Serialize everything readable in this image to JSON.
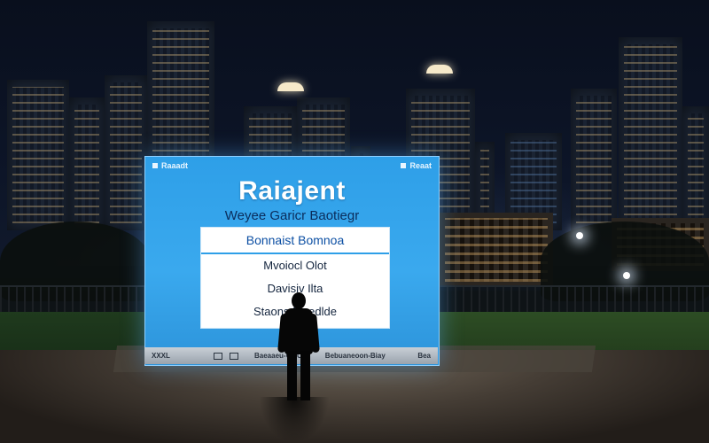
{
  "panel": {
    "topbar_left": "Raaadt",
    "topbar_right": "Reaat",
    "title": "Raiajent",
    "subtitle": "Weyee Garicr Baotiegr",
    "card": {
      "header": "Bonnaist Bomnoa",
      "items": [
        "Mvoiocl Olot",
        "Davisiv Ilta",
        "Staons Maedlde"
      ]
    },
    "footer": {
      "left": "XXXL",
      "mid1": "Baeaaeu-OOC",
      "mid2": "Bebuaneoon-Biay",
      "right": "Bea"
    }
  },
  "colors": {
    "panel_blue": "#2e9fe8",
    "card_header_text": "#0c4fa3",
    "subtitle_text": "#0b2d5c"
  }
}
